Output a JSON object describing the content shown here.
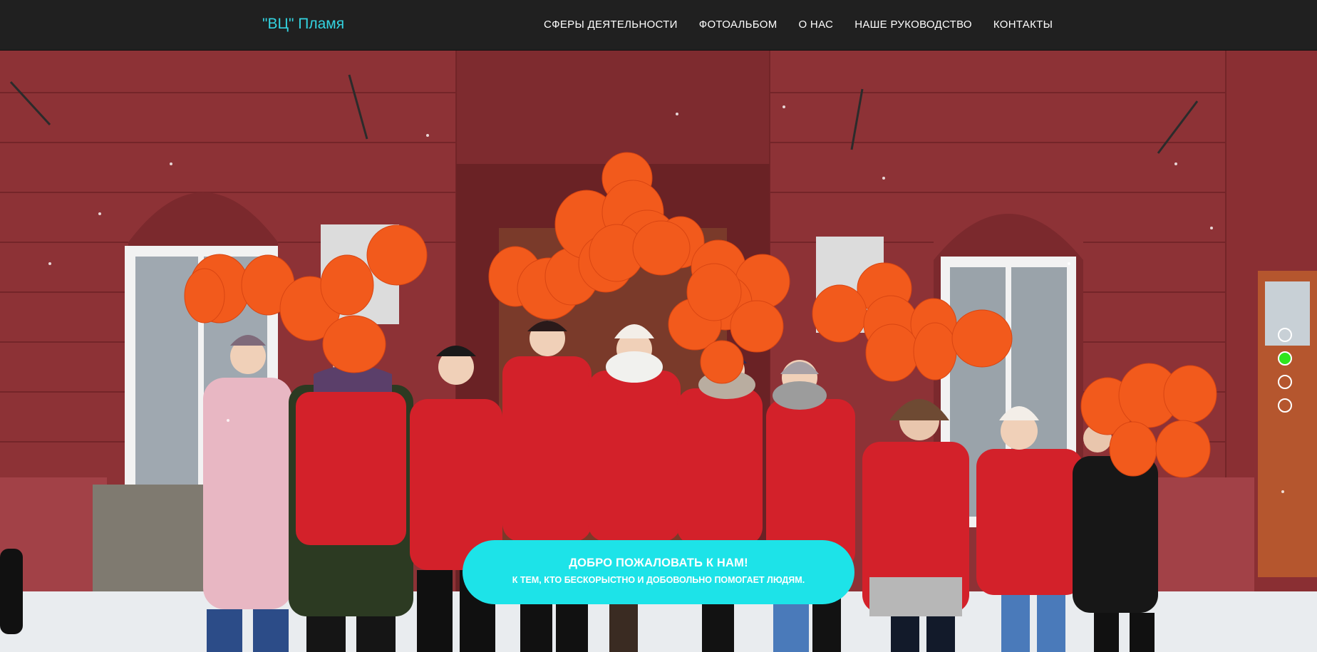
{
  "nav": {
    "brand": "\"ВЦ\" Пламя",
    "items": [
      {
        "label": "СФЕРЫ ДЕЯТЕЛЬНОСТИ"
      },
      {
        "label": "ФОТОАЛЬБОМ"
      },
      {
        "label": "О НАС"
      },
      {
        "label": "НАШЕ РУКОВОДСТВО"
      },
      {
        "label": "КОНТАКТЫ"
      }
    ]
  },
  "hero": {
    "image": "group-photo-volunteers-red-vests-orange-balloons",
    "welcome_title": "ДОБРО ПОЖАЛОВАТЬ К НАМ!",
    "welcome_subtitle": "К ТЕМ, КТО БЕСКОРЫСТНО И ДОБОВОЛЬНО ПОМОГАЕТ ЛЮДЯМ."
  },
  "slider": {
    "slide_count": 4,
    "active_index": 1
  },
  "colors": {
    "navbar_bg": "#202020",
    "brand": "#33d3e0",
    "pill": "#1de3e8",
    "active_dot": "#2fe51d"
  }
}
